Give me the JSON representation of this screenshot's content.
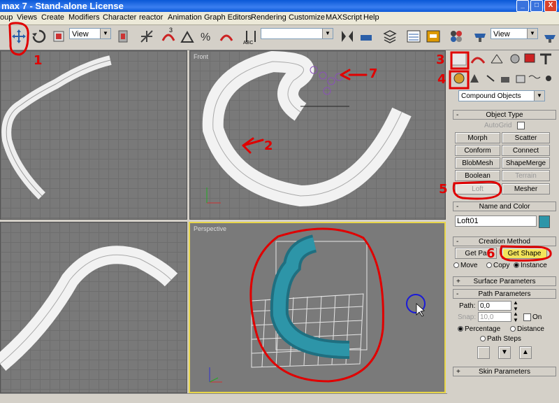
{
  "window": {
    "title": "max 7  - Stand-alone License",
    "controls": [
      "_",
      "□",
      "X"
    ]
  },
  "menu": [
    "oup",
    "Views",
    "Create",
    "Modifiers",
    "Character",
    "reactor",
    "Animation",
    "Graph Editors",
    "Rendering",
    "Customize",
    "MAXScript",
    "Help"
  ],
  "toolbar": {
    "view_dropdown": "View",
    "view_dropdown_right": "View",
    "named_sel": "",
    "num_label_3": "3",
    "num_label_abc": "ABC"
  },
  "viewports": {
    "top_right": "Front",
    "bottom_right": "Perspective"
  },
  "command_panel": {
    "category_dropdown": "Compound Objects",
    "object_type": {
      "title": "Object Type",
      "autogrid": "AutoGrid",
      "buttons": [
        "Morph",
        "Scatter",
        "Conform",
        "Connect",
        "BlobMesh",
        "ShapeMerge",
        "Boolean",
        "Terrain",
        "Loft",
        "Mesher"
      ]
    },
    "name_and_color": {
      "title": "Name and Color",
      "name": "Loft01",
      "color": "#2d95a8"
    },
    "creation_method": {
      "title": "Creation Method",
      "get_path": "Get Pa",
      "get_shape": "Get Shape",
      "move": "Move",
      "copy": "Copy",
      "instance": "Instance"
    },
    "surface_parameters": "Surface Parameters",
    "path_parameters": {
      "title": "Path Parameters",
      "path_label": "Path:",
      "path_value": "0,0",
      "snap_label": "Snap:",
      "snap_value": "10,0",
      "on": "On",
      "percentage": "Percentage",
      "distance": "Distance",
      "path_steps": "Path Steps"
    },
    "skin_parameters": "Skin Parameters"
  },
  "annotations": [
    "1",
    "2",
    "3",
    "4",
    "5",
    "6",
    "7"
  ],
  "colors": {
    "annotation": "#e00000",
    "loft_mesh": "#2d95a8",
    "active_viewport": "#e8d64a",
    "title_bar": "#0a58d6"
  }
}
